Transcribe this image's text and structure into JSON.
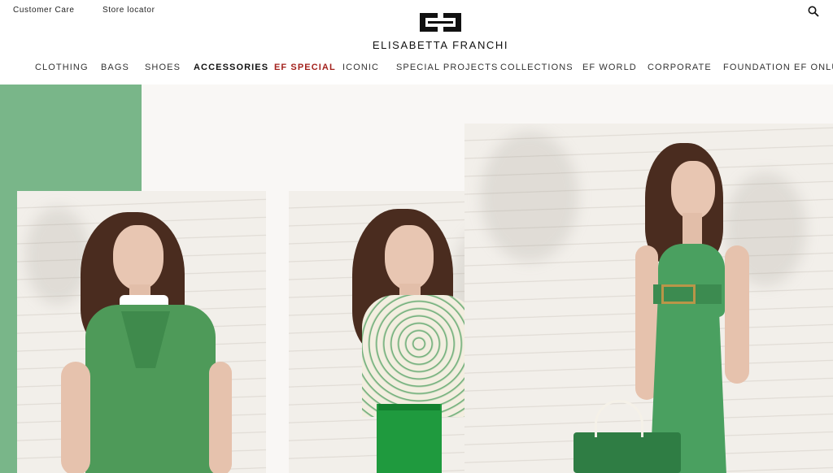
{
  "header": {
    "customer_care": "Customer Care",
    "store_locator": "Store locator",
    "brand_name": "ELISABETTA FRANCHI",
    "logo_icon": "ef-monogram-logo",
    "search_icon": "search-icon"
  },
  "nav": {
    "items": [
      {
        "label": "CLOTHING"
      },
      {
        "label": "BAGS"
      },
      {
        "label": "SHOES"
      },
      {
        "label": "ACCESSORIES",
        "state": "active"
      },
      {
        "label": "EF SPECIAL",
        "state": "highlight"
      },
      {
        "label": "ICONIC"
      },
      {
        "label": "SPECIAL PROJECTS"
      },
      {
        "label": "COLLECTIONS"
      },
      {
        "label": "EF WORLD"
      },
      {
        "label": "CORPORATE"
      },
      {
        "label": "FOUNDATION EF ONLUS"
      }
    ]
  },
  "hero": {
    "accent_color": "#79b689",
    "highlight_color": "#a3211c",
    "photos": [
      {
        "alt": "Model in green knit dress with white collar and bow"
      },
      {
        "alt": "Model in printed chain-link blouse and green skirt"
      },
      {
        "alt": "Model in green strapless jumpsuit with gold buckle belt holding a tote bag"
      }
    ]
  }
}
